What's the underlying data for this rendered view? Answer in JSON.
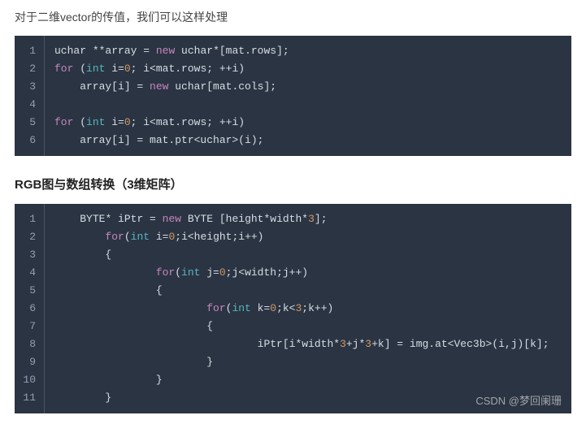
{
  "intro_text": "对于二维vector的传值，我们可以这样处理",
  "code1": {
    "gutter": [
      "1",
      "2",
      "3",
      "4",
      "5",
      "6"
    ],
    "l1": {
      "a": "uchar ",
      "b": "**",
      "c": "array",
      "d": " = ",
      "e": "new",
      "f": " uchar",
      "g": "*",
      "h": "[mat.rows];"
    },
    "l2": {
      "a": "for",
      "b": " (",
      "c": "int",
      "d": " i=",
      "e": "0",
      "f": "; i<mat.rows; ++i)"
    },
    "l3": {
      "a": "    array[i] = ",
      "b": "new",
      "c": " uchar[mat.cols];"
    },
    "l4": "",
    "l5": {
      "a": "for",
      "b": " (",
      "c": "int",
      "d": " i=",
      "e": "0",
      "f": "; i<mat.rows; ++i)"
    },
    "l6": {
      "a": "    array[i] = mat.ptr<uchar>(i);"
    }
  },
  "heading2": "RGB图与数组转换（3维矩阵）",
  "code2": {
    "gutter": [
      "1",
      "2",
      "3",
      "4",
      "5",
      "6",
      "7",
      "8",
      "9",
      "10",
      "11"
    ],
    "l1": {
      "pad": "    ",
      "a": "BYTE",
      "b": "* ",
      "c": "iPtr = ",
      "d": "new",
      "e": " BYTE [height*width*",
      "f": "3",
      "g": "];"
    },
    "l2": {
      "pad": "        ",
      "a": "for",
      "b": "(",
      "c": "int",
      "d": " i=",
      "e": "0",
      "f": ";i<height;i++)"
    },
    "l3": {
      "pad": "        ",
      "a": "{"
    },
    "l4": {
      "pad": "                ",
      "a": "for",
      "b": "(",
      "c": "int",
      "d": " j=",
      "e": "0",
      "f": ";j<width;j++)"
    },
    "l5": {
      "pad": "                ",
      "a": "{"
    },
    "l6": {
      "pad": "                        ",
      "a": "for",
      "b": "(",
      "c": "int",
      "d": " k=",
      "e": "0",
      "f": ";k<",
      "g": "3",
      "h": ";k++)"
    },
    "l7": {
      "pad": "                        ",
      "a": "{"
    },
    "l8": {
      "pad": "                                ",
      "a": "iPtr[i*width*",
      "b": "3",
      "c": "+j*",
      "d": "3",
      "e": "+k] = img.at<Vec3b>(i,j)[k];"
    },
    "l9": {
      "pad": "                        ",
      "a": "}"
    },
    "l10": {
      "pad": "                ",
      "a": "}"
    },
    "l11": {
      "pad": "        ",
      "a": "}"
    }
  },
  "watermark": "CSDN @梦回阑珊"
}
